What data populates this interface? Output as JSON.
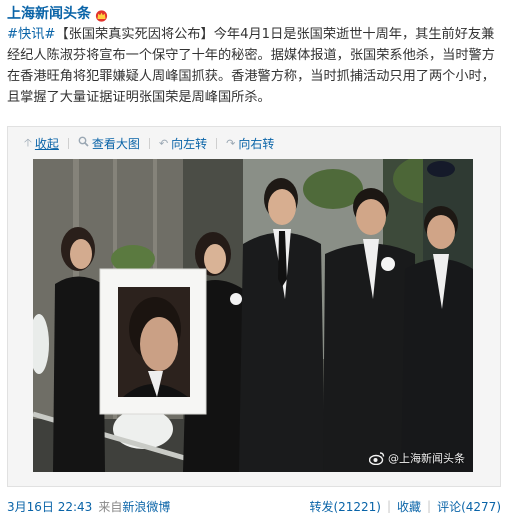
{
  "post": {
    "author": "上海新闻头条",
    "content": {
      "topic": "#快讯#",
      "text": "【张国荣真实死因将公布】今年4月1日是张国荣逝世十周年，其生前好友兼经纪人陈淑芬将宣布一个保守了十年的秘密。据媒体报道，张国荣系他杀，当时警方在香港旺角将犯罪嫌疑人周峰国抓获。香港警方称，当时抓捕活动只用了两个小时，且掌握了大量证据证明张国荣是周峰国所杀。"
    },
    "media_tools": {
      "collapse": "收起",
      "view_large": "查看大图",
      "rotate_left": "向左转",
      "rotate_right": "向右转"
    },
    "watermark": "@上海新闻头条",
    "footer": {
      "time": "3月16日 22:43",
      "from": "来自",
      "via": "新浪微博",
      "repost": "转发(21221)",
      "favorite": "收藏",
      "comment": "评论(4277)"
    },
    "icons": {
      "crown": "crown-icon",
      "collapse": "arrow-up-icon",
      "view_large": "magnify-icon",
      "rotate_left": "rotate-left-icon",
      "rotate_right": "rotate-right-icon",
      "watermark": "weibo-logo-icon"
    },
    "colors": {
      "link": "#0a64a8",
      "text": "#333333",
      "muted": "#888888"
    }
  }
}
